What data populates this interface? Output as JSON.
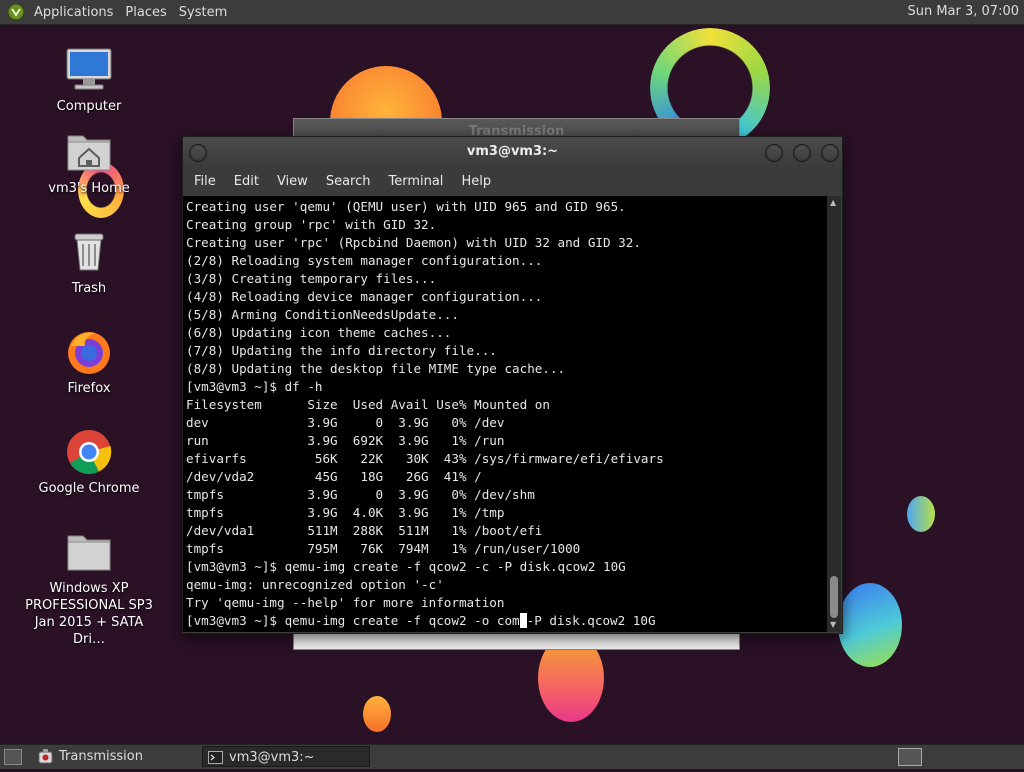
{
  "top_panel": {
    "menus": [
      "Applications",
      "Places",
      "System"
    ],
    "clock": "Sun Mar 3, 07:00"
  },
  "desktop": {
    "icons": [
      {
        "label": "Computer",
        "icon": "computer-icon"
      },
      {
        "label": "vm3's Home",
        "icon": "home-folder-icon"
      },
      {
        "label": "Trash",
        "icon": "trash-icon"
      },
      {
        "label": "Firefox",
        "icon": "firefox-icon"
      },
      {
        "label": "Google Chrome",
        "icon": "chrome-icon"
      },
      {
        "label": "Windows XP PROFESSIONAL SP3 Jan 2015 + SATA Dri…",
        "icon": "folder-icon"
      }
    ]
  },
  "background_window": {
    "title": "Transmission"
  },
  "terminal": {
    "title": "vm3@vm3:~",
    "menus": [
      "File",
      "Edit",
      "View",
      "Search",
      "Terminal",
      "Help"
    ],
    "lines": [
      "Creating user 'qemu' (QEMU user) with UID 965 and GID 965.",
      "Creating group 'rpc' with GID 32.",
      "Creating user 'rpc' (Rpcbind Daemon) with UID 32 and GID 32.",
      "(2/8) Reloading system manager configuration...",
      "(3/8) Creating temporary files...",
      "(4/8) Reloading device manager configuration...",
      "(5/8) Arming ConditionNeedsUpdate...",
      "(6/8) Updating icon theme caches...",
      "(7/8) Updating the info directory file...",
      "(8/8) Updating the desktop file MIME type cache...",
      "[vm3@vm3 ~]$ df -h",
      "Filesystem      Size  Used Avail Use% Mounted on",
      "dev             3.9G     0  3.9G   0% /dev",
      "run             3.9G  692K  3.9G   1% /run",
      "efivarfs         56K   22K   30K  43% /sys/firmware/efi/efivars",
      "/dev/vda2        45G   18G   26G  41% /",
      "tmpfs           3.9G     0  3.9G   0% /dev/shm",
      "tmpfs           3.9G  4.0K  3.9G   1% /tmp",
      "/dev/vda1       511M  288K  511M   1% /boot/efi",
      "tmpfs           795M   76K  794M   1% /run/user/1000",
      "[vm3@vm3 ~]$ qemu-img create -f qcow2 -c -P disk.qcow2 10G",
      "qemu-img: unrecognized option '-c'",
      "Try 'qemu-img --help' for more information"
    ],
    "prompt_before_cursor": "[vm3@vm3 ~]$ qemu-img create -f qcow2 -o com",
    "prompt_after_cursor": "-P disk.qcow2 10G"
  },
  "taskbar": {
    "tasks": [
      {
        "label": "Transmission",
        "icon": "transmission-icon"
      },
      {
        "label": "vm3@vm3:~",
        "icon": "terminal-icon"
      }
    ]
  }
}
